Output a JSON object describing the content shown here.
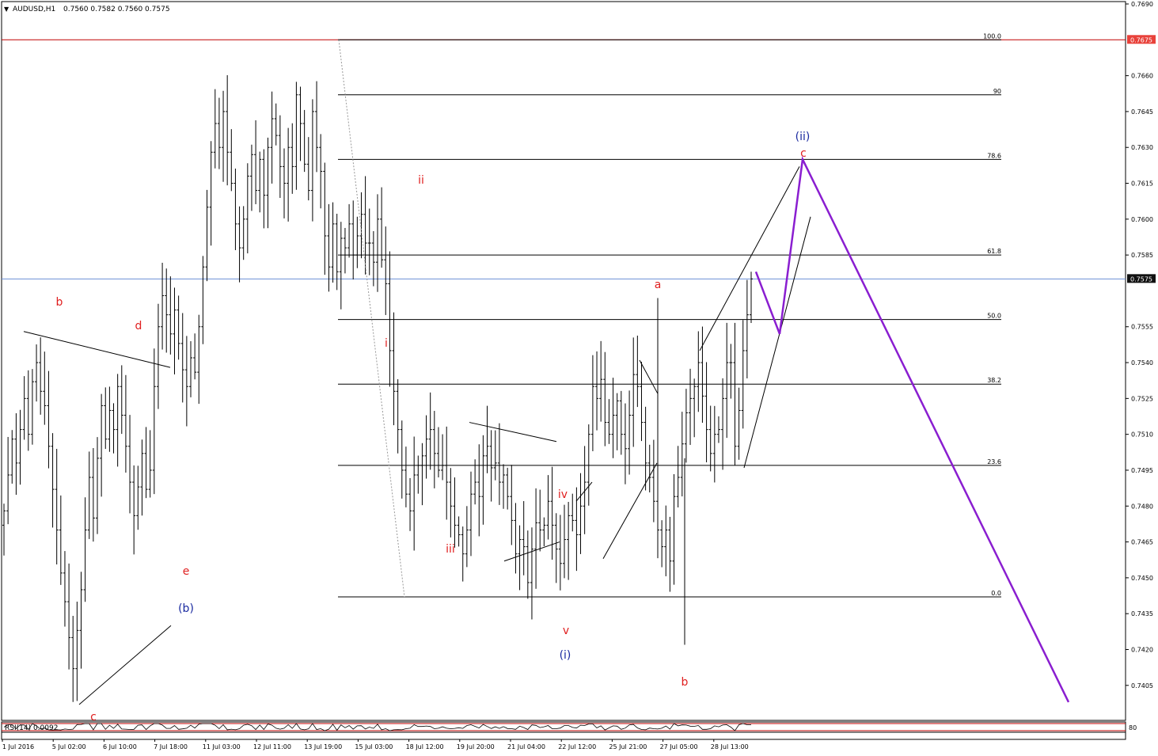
{
  "header": {
    "symbol": "AUDUSD,H1",
    "ohlc": "0.7560 0.7582 0.7560 0.7575",
    "indicator": "RSI(14) 0.0092"
  },
  "colors": {
    "grid_red": "#c00000",
    "current_price_line": "#6b8fd6",
    "wave_red": "#e02020",
    "wave_blue": "#1a2aa0",
    "projection": "#8a1ed0",
    "price_tag_red": "#e8413a",
    "price_tag_dark": "#111111"
  },
  "chart_data": {
    "type": "candlestick",
    "title": "AUDUSD,H1",
    "ylim": [
      0.7395,
      0.769
    ],
    "y_ticks": [
      "0.7690",
      "0.7675",
      "0.7660",
      "0.7645",
      "0.7630",
      "0.7615",
      "0.7600",
      "0.7585",
      "0.7575",
      "0.7555",
      "0.7540",
      "0.7525",
      "0.7510",
      "0.7495",
      "0.7480",
      "0.7465",
      "0.7450",
      "0.7435",
      "0.7420",
      "0.7405"
    ],
    "x_ticks": [
      "1 Jul 2016",
      "5 Jul 02:00",
      "6 Jul 10:00",
      "7 Jul 18:00",
      "11 Jul 03:00",
      "12 Jul 11:00",
      "13 Jul 19:00",
      "15 Jul 03:00",
      "18 Jul 12:00",
      "19 Jul 20:00",
      "21 Jul 04:00",
      "22 Jul 12:00",
      "25 Jul 21:00",
      "27 Jul 05:00",
      "28 Jul 13:00"
    ],
    "horizontal_lines": [
      {
        "name": "resistance",
        "value": 0.7675,
        "label": "0.7675"
      },
      {
        "name": "current_price",
        "value": 0.7575,
        "label": "0.7575"
      }
    ],
    "fibonacci": [
      {
        "level": "100.0",
        "value": 0.7675
      },
      {
        "level": "90",
        "value": 0.7652
      },
      {
        "level": "78.6",
        "value": 0.7625
      },
      {
        "level": "61.8",
        "value": 0.7585
      },
      {
        "level": "50.0",
        "value": 0.7558
      },
      {
        "level": "38.2",
        "value": 0.7531
      },
      {
        "level": "23.6",
        "value": 0.7497
      },
      {
        "level": "0.0",
        "value": 0.7442
      }
    ],
    "wave_labels": [
      {
        "text": "b",
        "color": "red"
      },
      {
        "text": "d",
        "color": "red"
      },
      {
        "text": "e",
        "color": "red"
      },
      {
        "text": "(b)",
        "color": "blue"
      },
      {
        "text": "c",
        "color": "red"
      },
      {
        "text": "ii",
        "color": "red"
      },
      {
        "text": "i",
        "color": "red"
      },
      {
        "text": "iii",
        "color": "red"
      },
      {
        "text": "iv",
        "color": "red"
      },
      {
        "text": "v",
        "color": "red"
      },
      {
        "text": "(i)",
        "color": "blue"
      },
      {
        "text": "a",
        "color": "red"
      },
      {
        "text": "b",
        "color": "red"
      },
      {
        "text": "(ii)",
        "color": "blue"
      },
      {
        "text": "c",
        "color": "red"
      }
    ],
    "series": [
      {
        "name": "AUDUSD,H1",
        "values": [
          0.7478,
          0.7493,
          0.7508,
          0.7498,
          0.7512,
          0.7525,
          0.751,
          0.7532,
          0.754,
          0.7528,
          0.7522,
          0.7505,
          0.7487,
          0.747,
          0.7452,
          0.744,
          0.7425,
          0.7412,
          0.7428,
          0.7445,
          0.747,
          0.7492,
          0.7475,
          0.75,
          0.7522,
          0.7508,
          0.752,
          0.7512,
          0.753,
          0.7518,
          0.7505,
          0.749,
          0.7476,
          0.7488,
          0.7502,
          0.7487,
          0.7495,
          0.753,
          0.7555,
          0.7568,
          0.756,
          0.7552,
          0.7562,
          0.7548,
          0.7537,
          0.753,
          0.7542,
          0.7536,
          0.7555,
          0.758,
          0.7605,
          0.7628,
          0.764,
          0.763,
          0.7645,
          0.7628,
          0.7615,
          0.7598,
          0.7588,
          0.76,
          0.7618,
          0.7627,
          0.7612,
          0.7625,
          0.761,
          0.763,
          0.7642,
          0.7635,
          0.7622,
          0.7615,
          0.763,
          0.7622,
          0.7652,
          0.764,
          0.7623,
          0.7612,
          0.7645,
          0.763,
          0.762,
          0.7593,
          0.758,
          0.7598,
          0.7578,
          0.7592,
          0.7588,
          0.7598,
          0.7585,
          0.7593,
          0.7602,
          0.759,
          0.759,
          0.7582,
          0.76,
          0.7583,
          0.7573,
          0.7545,
          0.7528,
          0.7512,
          0.7495,
          0.7485,
          0.7478,
          0.7493,
          0.7497,
          0.7501,
          0.7508,
          0.7512,
          0.7502,
          0.7495,
          0.7497,
          0.749,
          0.748,
          0.7472,
          0.7468,
          0.746,
          0.747,
          0.7485,
          0.749,
          0.7484,
          0.7501,
          0.7505,
          0.7496,
          0.7498,
          0.749,
          0.7493,
          0.7484,
          0.7474,
          0.746,
          0.7466,
          0.7463,
          0.7448,
          0.7462,
          0.7473,
          0.747,
          0.7472,
          0.7482,
          0.7472,
          0.7462,
          0.7456,
          0.7466,
          0.7476,
          0.7474,
          0.7468,
          0.748,
          0.749,
          0.751,
          0.753,
          0.7525,
          0.7533,
          0.7515,
          0.751,
          0.7518,
          0.7524,
          0.751,
          0.7504,
          0.7518,
          0.7535,
          0.753,
          0.7515,
          0.7498,
          0.7492,
          0.7482,
          0.747,
          0.7463,
          0.747,
          0.7457,
          0.7484,
          0.7492,
          0.7506,
          0.7519,
          0.7525,
          0.753,
          0.754,
          0.7526,
          0.7512,
          0.7502,
          0.751,
          0.7512,
          0.7525,
          0.754,
          0.754,
          0.7505,
          0.752,
          0.7545,
          0.756,
          0.7575
        ]
      }
    ]
  }
}
